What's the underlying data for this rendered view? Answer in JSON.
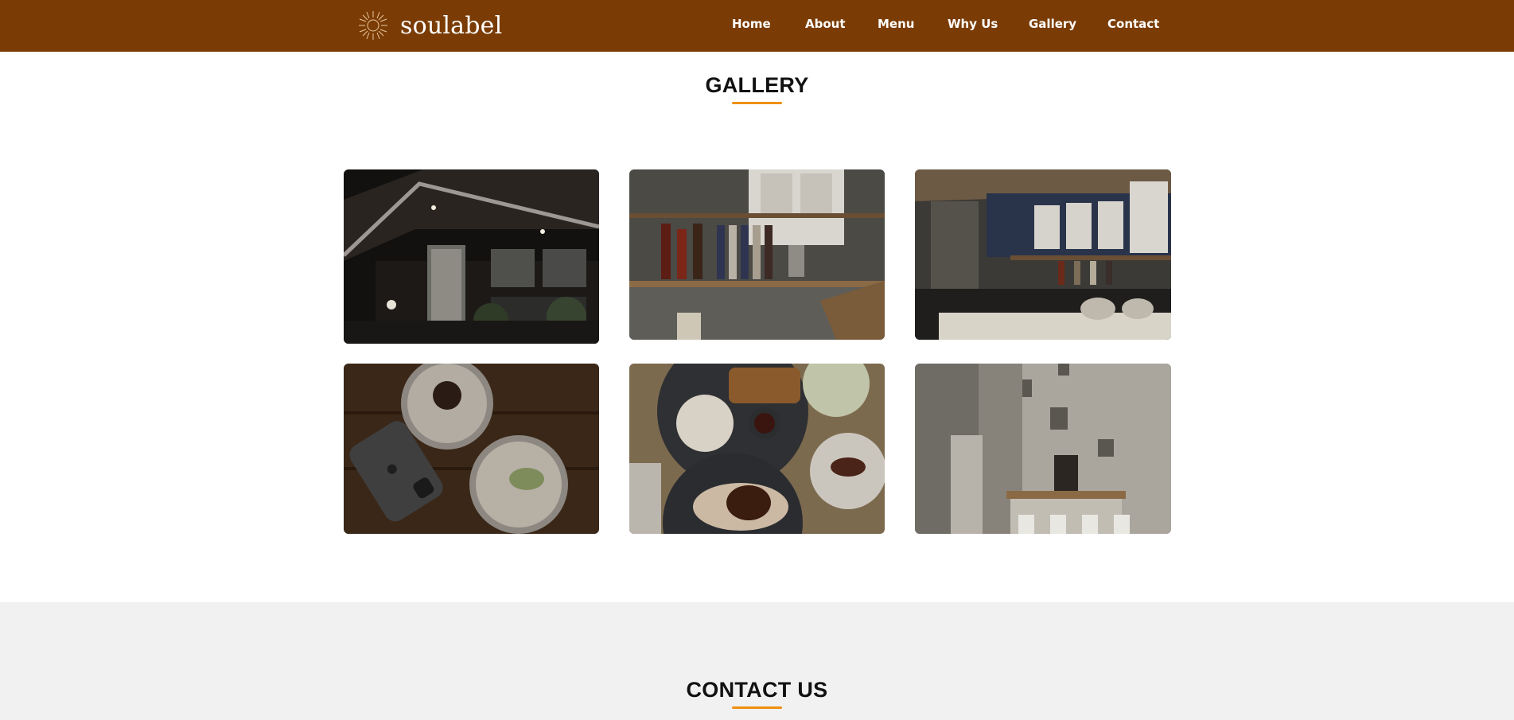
{
  "brand": {
    "name": "soulabel",
    "logo_icon": "sun-logo-icon"
  },
  "nav": {
    "items": [
      {
        "label": "Home"
      },
      {
        "label": "About"
      },
      {
        "label": "Menu"
      },
      {
        "label": "Why Us"
      },
      {
        "label": "Gallery"
      },
      {
        "label": "Contact"
      }
    ]
  },
  "gallery": {
    "title": "GALLERY",
    "images": [
      {
        "subject": "cafe-exterior-night"
      },
      {
        "subject": "coffee-bar-syrup-shelf"
      },
      {
        "subject": "counter-with-menu-boards"
      },
      {
        "subject": "lattes-and-phone-on-table"
      },
      {
        "subject": "rice-meals-and-drinks"
      },
      {
        "subject": "interior-seating-corner"
      }
    ]
  },
  "contact": {
    "title": "CONTACT US"
  },
  "colors": {
    "navbar": "#7a3c04",
    "accent": "#f0900f",
    "contact_band": "#f1f1f1",
    "heading_text": "#111111"
  }
}
